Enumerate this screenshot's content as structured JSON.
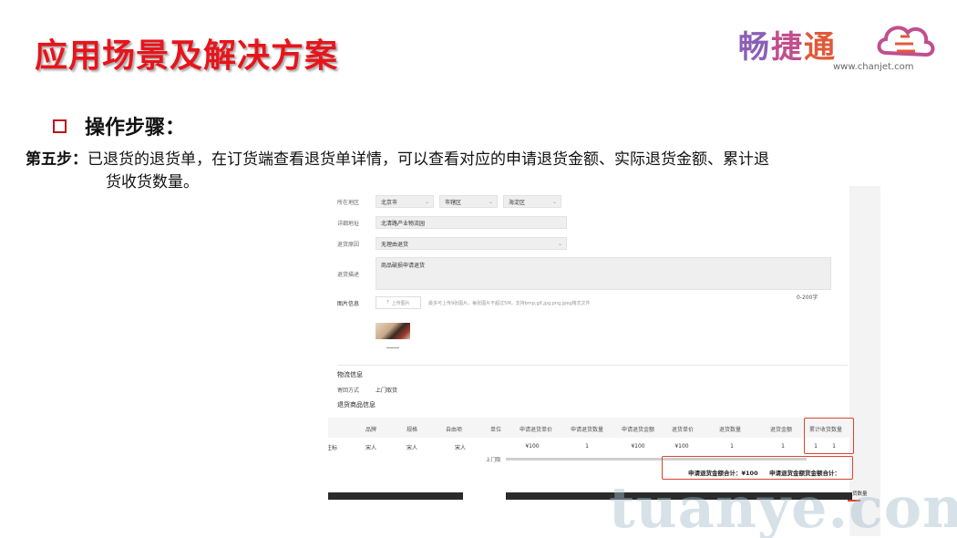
{
  "slide": {
    "title": "应用场景及解决方案",
    "step_heading": "操作步骤：",
    "step_label": "第五步：",
    "step_text_line1": "已退货的退货单，在订货端查看退货单详情，可以查看对应的申请退货金额、实际退货金额、累计退",
    "step_text_line2": "货收货数量。"
  },
  "logo": {
    "char1": "畅",
    "char2": "捷",
    "char3": "通",
    "url": "www.chanjet.com",
    "colors": [
      "#8a5fb5",
      "#c04f8e",
      "#e0593a"
    ]
  },
  "form": {
    "region_label": "所在地区",
    "province": "北京市",
    "city": "市辖区",
    "district": "海淀区",
    "address_label": "详细地址",
    "address_value": "北清路产业物流园",
    "reason_label": "退货原因",
    "reason_value": "无理由退货",
    "desc_label": "退货描述",
    "desc_value": "商品破损申请退货",
    "char_count": "0-200字",
    "image_label": "图片信息",
    "upload_button": "上传图片",
    "upload_hint": "最多可上传9张图片，每张图片不超过5M，支持bmp,gif,jpg,png,jpeg格式文件"
  },
  "logistics": {
    "section_title": "物流信息",
    "method_label": "寄回方式",
    "method_value": "上门取货",
    "goods_title": "退货商品信息"
  },
  "table": {
    "headers": [
      "品牌",
      "规格",
      "自由项",
      "单位",
      "申请退货单价",
      "申请退货数量",
      "申请退货金额",
      "退货单价",
      "退货数量",
      "退货金额",
      "累计收货数量"
    ],
    "row": {
      "first_cell": "注标",
      "brand": "宋人",
      "spec": "宋人",
      "free": "宋人",
      "apply_price": "¥100",
      "apply_qty": "1",
      "apply_amount": "¥100",
      "return_price": "¥100",
      "return_qty": "1",
      "return_amount": "1",
      "cum_qty_a": "1",
      "cum_qty_b": "1"
    },
    "stray_label": "上门取",
    "apply_total": "申请退货金额合计：¥100",
    "actual_total": "申请退货金额货金额合计：",
    "corner_text": "货数量"
  },
  "watermark": "tuanye.com",
  "accent_color": "#e8141b"
}
